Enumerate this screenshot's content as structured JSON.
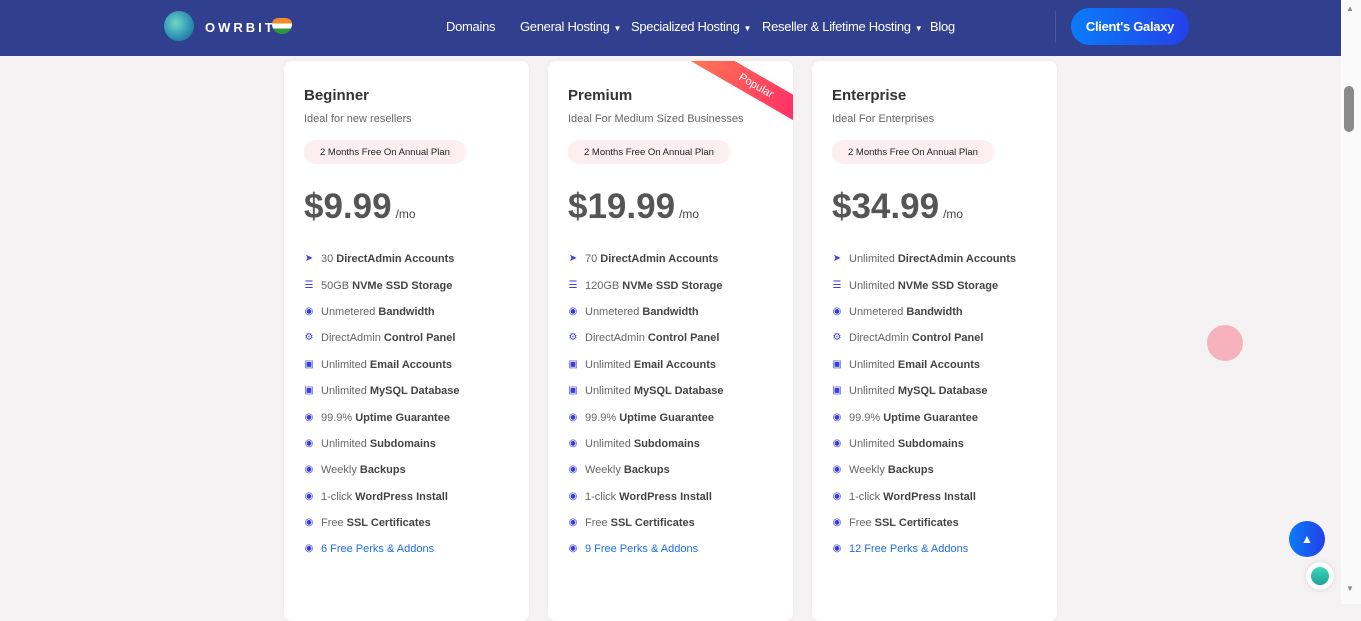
{
  "nav": {
    "brand": "OWRBIT",
    "items": [
      {
        "label": "Domains",
        "dropdown": false
      },
      {
        "label": "General Hosting",
        "dropdown": true
      },
      {
        "label": "Specialized Hosting",
        "dropdown": true
      },
      {
        "label": "Reseller & Lifetime Hosting",
        "dropdown": true
      },
      {
        "label": "Blog",
        "dropdown": false
      }
    ],
    "cta": "Client's Galaxy"
  },
  "ribbon": "Popular",
  "colors": {
    "nav": "#313f8f",
    "accent": "#2340ea",
    "ribbon": "#ff1e6a",
    "link": "#1f6ee8"
  },
  "plans": [
    {
      "name": "Beginner",
      "subtitle": "Ideal for new resellers",
      "badge": "2 Months Free On Annual Plan",
      "price": "$9.99",
      "per": "/mo",
      "features": [
        [
          "30",
          "DirectAdmin Accounts"
        ],
        [
          "50GB",
          "NVMe SSD Storage"
        ],
        [
          "Unmetered",
          "Bandwidth"
        ],
        [
          "DirectAdmin",
          "Control Panel"
        ],
        [
          "Unlimited",
          "Email Accounts"
        ],
        [
          "Unlimited",
          "MySQL Database"
        ],
        [
          "99.9%",
          "Uptime Guarantee"
        ],
        [
          "Unlimited",
          "Subdomains"
        ],
        [
          "Weekly",
          "Backups"
        ],
        [
          "1-click",
          "WordPress Install"
        ],
        [
          "Free",
          "SSL Certificates"
        ]
      ],
      "perks_count": "6",
      "perks_label": "Free Perks & Addons"
    },
    {
      "name": "Premium",
      "subtitle": "Ideal For Medium Sized Businesses",
      "badge": "2 Months Free On Annual Plan",
      "price": "$19.99",
      "per": "/mo",
      "features": [
        [
          "70",
          "DirectAdmin Accounts"
        ],
        [
          "120GB",
          "NVMe SSD Storage"
        ],
        [
          "Unmetered",
          "Bandwidth"
        ],
        [
          "DirectAdmin",
          "Control Panel"
        ],
        [
          "Unlimited",
          "Email Accounts"
        ],
        [
          "Unlimited",
          "MySQL Database"
        ],
        [
          "99.9%",
          "Uptime Guarantee"
        ],
        [
          "Unlimited",
          "Subdomains"
        ],
        [
          "Weekly",
          "Backups"
        ],
        [
          "1-click",
          "WordPress Install"
        ],
        [
          "Free",
          "SSL Certificates"
        ]
      ],
      "perks_count": "9",
      "perks_label": "Free Perks & Addons"
    },
    {
      "name": "Enterprise",
      "subtitle": "Ideal For Enterprises",
      "badge": "2 Months Free On Annual Plan",
      "price": "$34.99",
      "per": "/mo",
      "features": [
        [
          "Unlimited",
          "DirectAdmin Accounts"
        ],
        [
          "Unlimited",
          "NVMe SSD Storage"
        ],
        [
          "Unmetered",
          "Bandwidth"
        ],
        [
          "DirectAdmin",
          "Control Panel"
        ],
        [
          "Unlimited",
          "Email Accounts"
        ],
        [
          "Unlimited",
          "MySQL Database"
        ],
        [
          "99.9%",
          "Uptime Guarantee"
        ],
        [
          "Unlimited",
          "Subdomains"
        ],
        [
          "Weekly",
          "Backups"
        ],
        [
          "1-click",
          "WordPress Install"
        ],
        [
          "Free",
          "SSL Certificates"
        ]
      ],
      "perks_count": "12",
      "perks_label": "Free Perks & Addons"
    }
  ],
  "feature_icons": [
    "rocket-icon",
    "database-icon",
    "globe-icon",
    "gears-icon",
    "briefcase-icon",
    "briefcase-icon",
    "globe-icon",
    "globe-icon",
    "globe-icon",
    "globe-icon",
    "globe-icon"
  ]
}
